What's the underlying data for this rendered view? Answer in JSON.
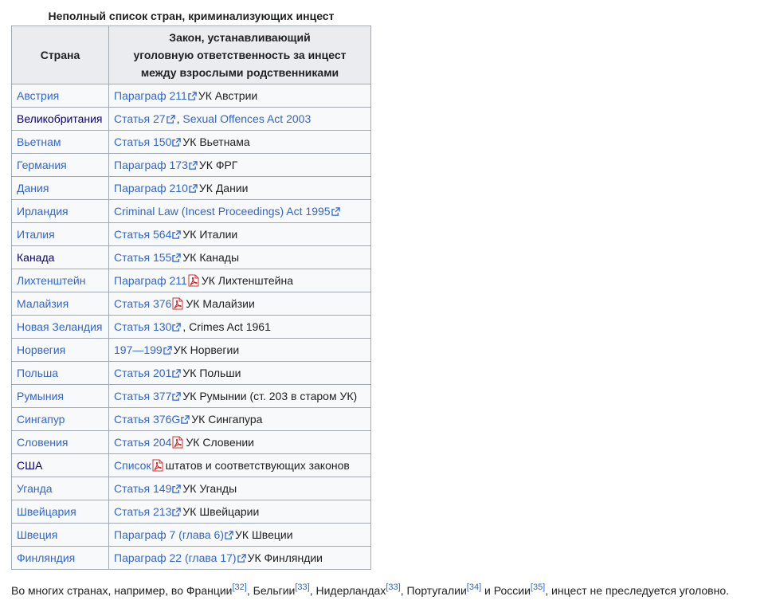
{
  "caption": "Неполный список стран, криминализующих инцест",
  "headers": {
    "country": "Страна",
    "law_line1": "Закон, устанавливающий",
    "law_line2": "уголовную ответственность за инцест",
    "law_line3": "между взрослыми родственниками"
  },
  "rows": [
    {
      "country": "Австрия",
      "visited": false,
      "link": "Параграф 211",
      "icon": "external-link-icon",
      "rest": "УК Австрии"
    },
    {
      "country": "Великобритания",
      "visited": true,
      "link": "Статья 27",
      "icon": "external-link-icon",
      "sep": ", ",
      "link2": "Sexual Offences Act 2003",
      "rest": ""
    },
    {
      "country": "Вьетнам",
      "visited": false,
      "link": "Статья 150",
      "icon": "external-link-icon",
      "rest": "УК Вьетнама"
    },
    {
      "country": "Германия",
      "visited": false,
      "link": "Параграф 173",
      "icon": "external-link-icon",
      "rest": "УК ФРГ"
    },
    {
      "country": "Дания",
      "visited": false,
      "link": "Параграф 210",
      "icon": "external-link-icon",
      "rest": "УК Дании"
    },
    {
      "country": "Ирландия",
      "visited": false,
      "link": "Criminal Law (Incest Proceedings) Act 1995",
      "icon": "external-link-icon",
      "rest": ""
    },
    {
      "country": "Италия",
      "visited": false,
      "link": "Статья 564",
      "icon": "external-link-icon",
      "rest": "УК Италии"
    },
    {
      "country": "Канада",
      "visited": true,
      "link": "Статья 155",
      "icon": "external-link-icon",
      "rest": "УК Канады"
    },
    {
      "country": "Лихтенштейн",
      "visited": false,
      "link": "Параграф 211",
      "icon": "pdf-icon",
      "rest": "УК Лихтенштейна"
    },
    {
      "country": "Малайзия",
      "visited": false,
      "link": "Статья 376",
      "icon": "pdf-icon",
      "rest": "УК Малайзии"
    },
    {
      "country": "Новая Зеландия",
      "visited": false,
      "link": "Статья 130",
      "icon": "external-link-icon",
      "rest": ", Crimes Act 1961"
    },
    {
      "country": "Норвегия",
      "visited": false,
      "link": "197—199",
      "icon": "external-link-icon",
      "rest": "УК Норвегии"
    },
    {
      "country": "Польша",
      "visited": false,
      "link": "Статья 201",
      "icon": "external-link-icon",
      "rest": "УК Польши"
    },
    {
      "country": "Румыния",
      "visited": false,
      "link": "Статья 377",
      "icon": "external-link-icon",
      "rest": "УК Румынии (ст. 203 в старом УК)"
    },
    {
      "country": "Сингапур",
      "visited": false,
      "link": "Статья 376G",
      "icon": "external-link-icon",
      "rest": "УК Сингапура"
    },
    {
      "country": "Словения",
      "visited": false,
      "link": "Статья 204",
      "icon": "pdf-icon",
      "rest": "УК Словении"
    },
    {
      "country": "США",
      "visited": true,
      "link": "Список",
      "icon": "pdf-icon",
      "rest": "штатов и соответствующих законов"
    },
    {
      "country": "Уганда",
      "visited": false,
      "link": "Статья 149",
      "icon": "external-link-icon",
      "rest": "УК Уганды"
    },
    {
      "country": "Швейцария",
      "visited": false,
      "link": "Статья 213",
      "icon": "external-link-icon",
      "rest": "УК Швейцарии"
    },
    {
      "country": "Швеция",
      "visited": false,
      "link": "Параграф 7 (глава 6)",
      "icon": "external-link-icon",
      "rest": "УК Швеции"
    },
    {
      "country": "Финляндия",
      "visited": false,
      "link": "Параграф 22 (глава 17)",
      "icon": "external-link-icon",
      "rest": "УК Финляндии"
    }
  ],
  "footer": {
    "t1": "Во многих странах, например, во Франции",
    "r1": "[32]",
    "t2": ", Бельгии",
    "r2": "[33]",
    "t3": ", Нидерландах",
    "r3": "[33]",
    "t4": ", Португалии",
    "r4": "[34]",
    "t5": " и России",
    "r5": "[35]",
    "t6": ", инцест не преследуется уголовно."
  },
  "colors": {
    "link": "#3366cc",
    "visited_link": "#0b0080",
    "text": "#202122",
    "table_border": "#a2a9b1",
    "header_bg": "#eaecf0",
    "cell_bg": "#f8f9fa",
    "pdf_red": "#d22"
  }
}
